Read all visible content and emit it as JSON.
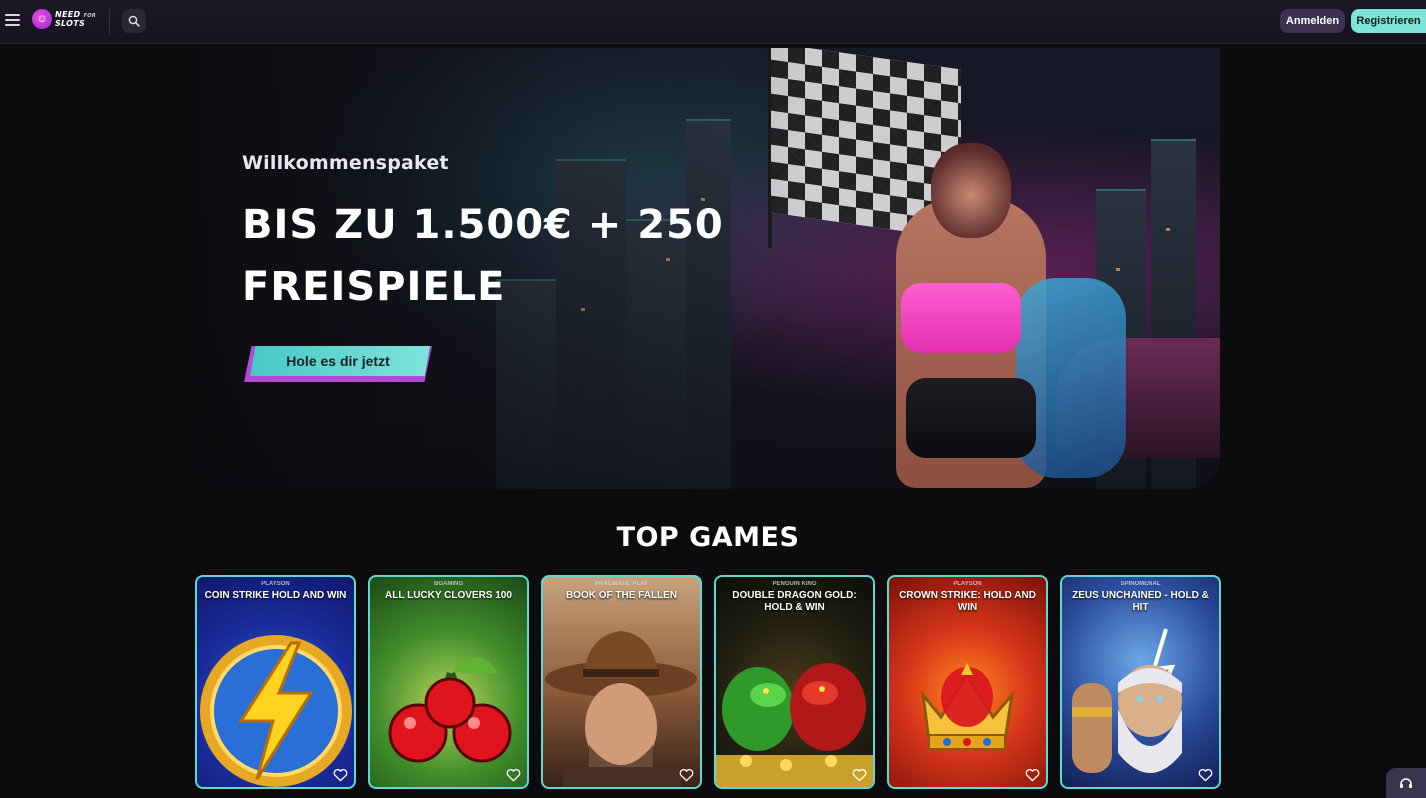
{
  "header": {
    "menu_icon": "hamburger-menu-icon",
    "logo": {
      "line1": "NEED",
      "line2": "FOR",
      "line3": "SLOTS"
    },
    "search_icon": "search-icon",
    "login_label": "Anmelden",
    "register_label": "Registrieren",
    "colors": {
      "register_bg": "#7ee3d6",
      "login_bg": "#3a3250"
    }
  },
  "hero": {
    "eyebrow": "Willkommenspaket",
    "title_line1": "BIS ZU 1.500€ + 250",
    "title_line2": "FREISPIELE",
    "cta_label": "Hole es dir jetzt"
  },
  "top_games": {
    "title": "TOP GAMES",
    "items": [
      {
        "provider": "PLAYSON",
        "title": "COIN STRIKE HOLD AND WIN",
        "art": "lightning-coin-icon"
      },
      {
        "provider": "BGAMING",
        "title": "ALL LUCKY CLOVERS 100",
        "art": "cherries-icon"
      },
      {
        "provider": "PRAGMATIC PLAY",
        "title": "BOOK OF THE FALLEN",
        "art": "cowboy-portrait"
      },
      {
        "provider": "PENGUIN KING",
        "title": "DOUBLE DRAGON GOLD: HOLD & WIN",
        "art": "dragons-icon"
      },
      {
        "provider": "PLAYSON",
        "title": "CROWN STRIKE: HOLD AND WIN",
        "art": "crown-icon"
      },
      {
        "provider": "SPINOMENAL",
        "title": "ZEUS UNCHAINED - HOLD & HIT",
        "art": "zeus-portrait"
      }
    ],
    "favorite_icon": "heart-outline-icon"
  },
  "support": {
    "icon": "headset-icon"
  },
  "theme": {
    "accent": "#5fd8d2",
    "purple": "#b24ad6",
    "background": "#0c0c0f"
  }
}
